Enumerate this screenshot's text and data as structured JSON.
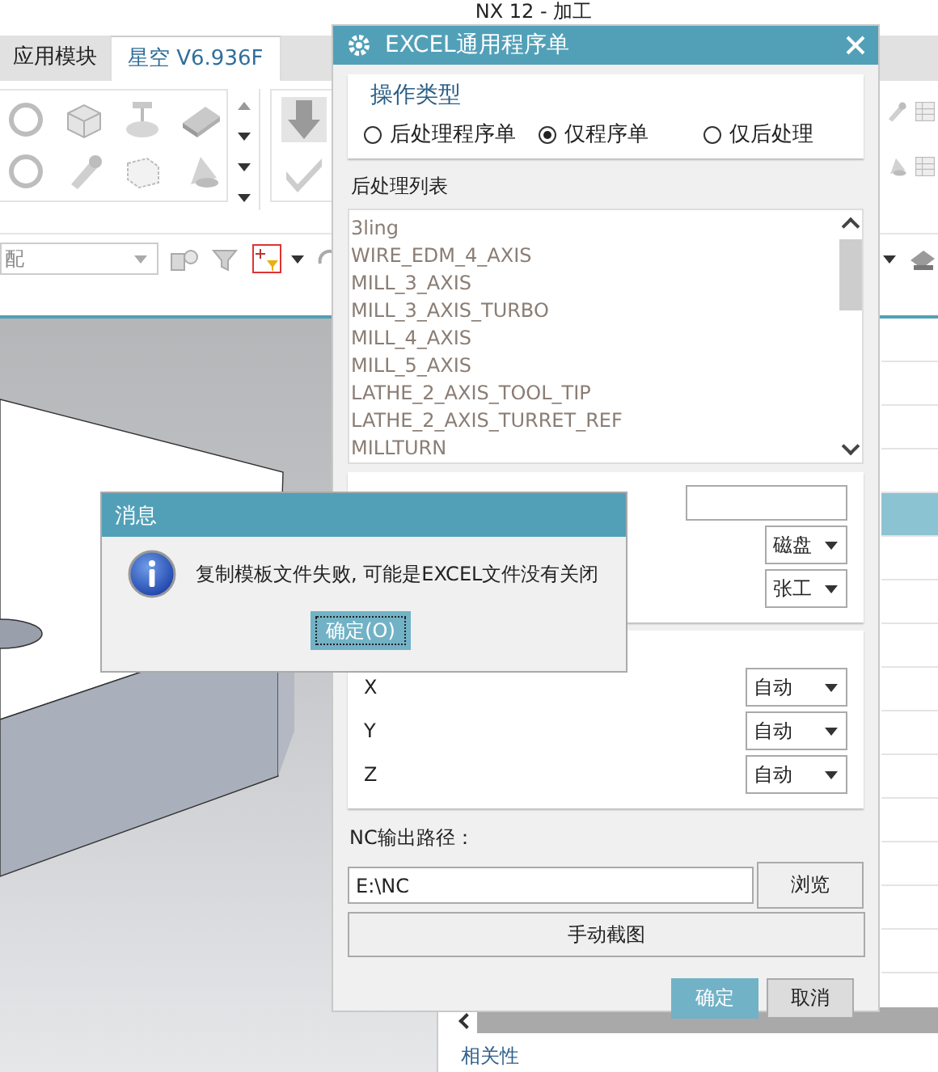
{
  "app": {
    "title": "NX 12 - 加工",
    "tabs": [
      {
        "label": "应用模块",
        "selected": false
      },
      {
        "label": "星空 V6.936F",
        "selected": true
      }
    ],
    "selection_filter": {
      "value": "配"
    },
    "navigator": {
      "rows": [
        {
          "selected": false
        },
        {
          "selected": false
        },
        {
          "selected": false
        },
        {
          "selected": false
        },
        {
          "selected": true
        },
        {
          "selected": false
        },
        {
          "selected": false
        },
        {
          "selected": false
        },
        {
          "selected": false
        },
        {
          "selected": false
        },
        {
          "selected": false
        },
        {
          "selected": false
        },
        {
          "selected": false
        },
        {
          "selected": false
        },
        {
          "selected": false
        }
      ],
      "footer": "相关性"
    }
  },
  "dialog": {
    "title": "EXCEL通用程序单",
    "operation_type": {
      "title": "操作类型",
      "options": [
        {
          "label": "后处理程序单",
          "selected": false
        },
        {
          "label": "仅程序单",
          "selected": true
        },
        {
          "label": "仅后处理",
          "selected": false
        }
      ]
    },
    "postprocessor_list": {
      "title": "后处理列表",
      "items": [
        "3ling",
        "WIRE_EDM_4_AXIS",
        "MILL_3_AXIS",
        "MILL_3_AXIS_TURBO",
        "MILL_4_AXIS",
        "MILL_5_AXIS",
        "LATHE_2_AXIS_TOOL_TIP",
        "LATHE_2_AXIS_TURRET_REF",
        "MILLTURN"
      ]
    },
    "fields": [
      {
        "kind": "text"
      },
      {
        "kind": "dropdown",
        "value": "磁盘"
      },
      {
        "kind": "dropdown",
        "value": "张工"
      }
    ],
    "axes": [
      {
        "label": "X",
        "value": "自动"
      },
      {
        "label": "Y",
        "value": "自动"
      },
      {
        "label": "Z",
        "value": "自动"
      }
    ],
    "nc_path": {
      "label": "NC输出路径：",
      "value": "E:\\NC",
      "browse": "浏览"
    },
    "capture_button": "手动截图",
    "buttons": [
      {
        "kind": "primary",
        "label": "确定"
      },
      {
        "kind": "secondary",
        "label": "取消"
      }
    ]
  },
  "message": {
    "title": "消息",
    "text": "复制模板文件失败, 可能是EXCEL文件没有关闭",
    "button": "确定(O)"
  }
}
